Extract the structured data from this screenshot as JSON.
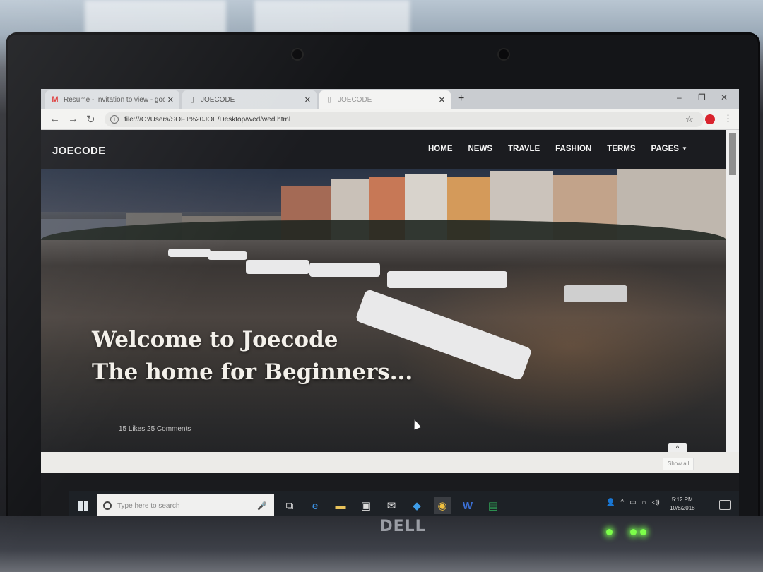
{
  "browser": {
    "tabs": [
      {
        "label": "Resume - Invitation to view - goo",
        "icon": "gmail-icon"
      },
      {
        "label": "JOECODE",
        "icon": "page-icon"
      },
      {
        "label": "JOECODE",
        "icon": "page-icon"
      }
    ],
    "new_tab_glyph": "+",
    "address": "file:///C:/Users/SOFT%20JOE/Desktop/wed/wed.html"
  },
  "site": {
    "brand": "JOECODE",
    "nav": [
      "HOME",
      "NEWS",
      "TRAVLE",
      "FASHION",
      "TERMS",
      "PAGES"
    ],
    "hero_line1": "Welcome to Joecode",
    "hero_line2": "The home for Beginners...",
    "meta": "15 Likes  25 Comments",
    "show_all": "Show all"
  },
  "taskbar": {
    "search_placeholder": "Type here to search",
    "time": "5:12 PM",
    "date": "10/8/2018"
  },
  "hardware": {
    "brand_logo": "DELL"
  },
  "colors": {
    "navbar_bg": "#1b1c20",
    "hero_text": "#f3f0ea",
    "profile_accent": "#d9232d"
  }
}
